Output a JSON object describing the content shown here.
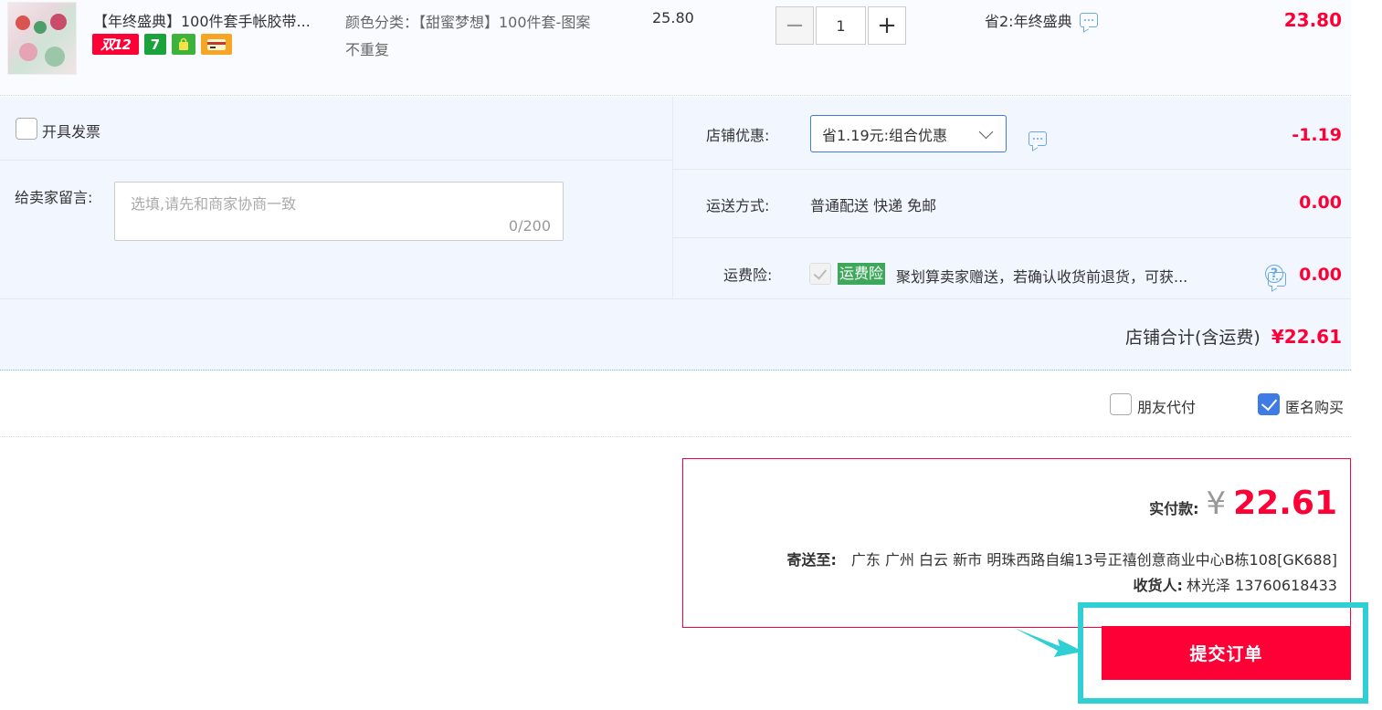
{
  "product": {
    "title": "【年终盛典】100件套手帐胶带...",
    "badges": [
      "双12",
      "7"
    ],
    "sku_label": "颜色分类：【甜蜜梦想】100件套-图案不重复",
    "unit_price": "25.80",
    "quantity": "1",
    "minus": "−",
    "plus": "+",
    "promo": "省2:年终盛典",
    "subtotal": "23.80"
  },
  "options": {
    "invoice_label": "开具发票",
    "memo_label": "给卖家留言:",
    "memo_placeholder": "选填,请先和商家协商一致",
    "memo_count": "0/200",
    "shop_discount_label": "店铺优惠:",
    "shop_discount_value": "省1.19元:组合优惠",
    "shop_discount_amount": "-1.19",
    "shipping_label": "运送方式:",
    "shipping_value": "普通配送 快递 免邮",
    "shipping_amount": "0.00",
    "insurance_label": "运费险:",
    "insurance_tag": "运费险",
    "insurance_text": "聚划算卖家赠送，若确认收货前退货，可获...",
    "insurance_help": "?",
    "insurance_amount": "0.00",
    "shop_total_label": "店铺合计(含运费)",
    "shop_total_value": "¥22.61"
  },
  "pay_options": {
    "friend_pay": "朋友代付",
    "anonymous": "匿名购买"
  },
  "summary": {
    "pay_label": "实付款:",
    "currency": "¥",
    "pay_amount": "22.61",
    "ship_to_label": "寄送至:",
    "address": "广东 广州 白云 新市 明珠西路自编13号正禧创意商业中心B栋108[GK688]",
    "receiver_label": "收货人:",
    "receiver": "林光泽 13760618433"
  },
  "submit_label": "提交订单",
  "colors": {
    "accent_red": "#ff0036",
    "highlight_cyan": "#2fcfd3",
    "panel_bg": "#f2f7ff",
    "link_blue": "#3e7be5"
  }
}
